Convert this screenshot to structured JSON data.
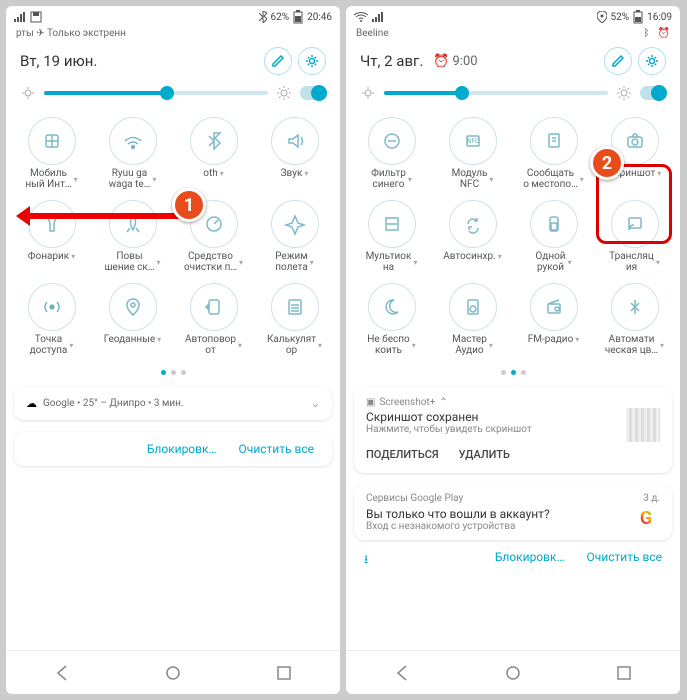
{
  "left": {
    "carrier": "рты ✈ Только экстренн",
    "battery": "62%",
    "time": "20:46",
    "date": "Вт, 19 июн.",
    "brightness_pct": 55,
    "tiles_row1": [
      {
        "label": "Мобиль\nный Инт…",
        "icon": "globe"
      },
      {
        "label": "Ryuu ga\nwaga te…",
        "icon": "wifi"
      },
      {
        "label": "oth",
        "icon": "bluetooth"
      },
      {
        "label": "Звук",
        "icon": "volume"
      }
    ],
    "tiles_row2": [
      {
        "label": "Фонарик",
        "icon": "flashlight"
      },
      {
        "label": "Повы\nшение ск…",
        "icon": "rocket"
      },
      {
        "label": "Средство\nочистки п…",
        "icon": "speed"
      },
      {
        "label": "Режим\nполета",
        "icon": "plane"
      }
    ],
    "tiles_row3": [
      {
        "label": "Точка\nдоступа",
        "icon": "hotspot"
      },
      {
        "label": "Геоданные",
        "icon": "location"
      },
      {
        "label": "Автоповор\nот",
        "icon": "rotate"
      },
      {
        "label": "Калькулят\nор",
        "icon": "calc"
      }
    ],
    "weather": "Google • 25° – Днипро • 3 мин.",
    "action_block": "Блокировк…",
    "action_clear": "Очистить все"
  },
  "right": {
    "carrier": "Beeline",
    "battery": "52%",
    "time": "16:09",
    "date": "Чт, 2 авг.",
    "alarm": "9:00",
    "brightness_pct": 35,
    "tiles_row1": [
      {
        "label": "Фильтр\nсинего",
        "icon": "filter"
      },
      {
        "label": "Модуль\nNFC",
        "icon": "nfc"
      },
      {
        "label": "Сообщать\nо местопо…",
        "icon": "report"
      },
      {
        "label": "Скриншот",
        "icon": "camera"
      }
    ],
    "tiles_row2": [
      {
        "label": "Мультиок\nна",
        "icon": "multiwin"
      },
      {
        "label": "Автосинхр.",
        "icon": "sync"
      },
      {
        "label": "Одной\nрукой",
        "icon": "onehand"
      },
      {
        "label": "Трансляц\nия",
        "icon": "cast"
      }
    ],
    "tiles_row3": [
      {
        "label": "Не беспо\nкоить",
        "icon": "moon"
      },
      {
        "label": "Мастер\nАудио",
        "icon": "audio"
      },
      {
        "label": "FM-радио",
        "icon": "radio"
      },
      {
        "label": "Автомати\nческая цв…",
        "icon": "autocolor"
      }
    ],
    "notif_app": "Screenshot+",
    "notif_title": "Скриншот сохранен",
    "notif_sub": "Нажмите, чтобы увидеть скриншот",
    "notif_share": "ПОДЕЛИТЬСЯ",
    "notif_delete": "УДАЛИТЬ",
    "notif2_app": "Сервисы Google Play",
    "notif2_time": "3 д.",
    "notif2_title": "Вы только что вошли в аккаунт?",
    "notif2_sub": "Вход с незнакомого устройства",
    "action_block": "Блокировк…",
    "action_clear": "Очистить все"
  },
  "markers": {
    "m1": "1",
    "m2": "2"
  }
}
